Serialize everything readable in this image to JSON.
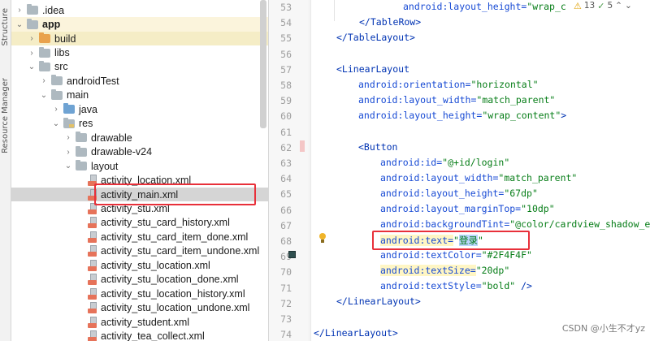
{
  "side_strip": {
    "labels": [
      "Structure",
      "Resource Manager"
    ]
  },
  "project_tree": {
    "items": [
      {
        "label": ".idea",
        "icon": "folder-icon"
      },
      {
        "label": "app",
        "icon": "folder-icon"
      },
      {
        "label": "build",
        "icon": "folder-icon"
      },
      {
        "label": "libs",
        "icon": "folder-icon"
      },
      {
        "label": "src",
        "icon": "folder-icon"
      },
      {
        "label": "androidTest",
        "icon": "folder-icon"
      },
      {
        "label": "main",
        "icon": "folder-icon"
      },
      {
        "label": "java",
        "icon": "folder-icon"
      },
      {
        "label": "res",
        "icon": "folder-icon"
      },
      {
        "label": "drawable",
        "icon": "folder-icon"
      },
      {
        "label": "drawable-v24",
        "icon": "folder-icon"
      },
      {
        "label": "layout",
        "icon": "folder-icon"
      },
      {
        "label": "activity_location.xml",
        "icon": "xml-file-icon"
      },
      {
        "label": "activity_main.xml",
        "icon": "xml-file-icon"
      },
      {
        "label": "activity_stu.xml",
        "icon": "xml-file-icon"
      },
      {
        "label": "activity_stu_card_history.xml",
        "icon": "xml-file-icon"
      },
      {
        "label": "activity_stu_card_item_done.xml",
        "icon": "xml-file-icon"
      },
      {
        "label": "activity_stu_card_item_undone.xml",
        "icon": "xml-file-icon"
      },
      {
        "label": "activity_stu_location.xml",
        "icon": "xml-file-icon"
      },
      {
        "label": "activity_stu_location_done.xml",
        "icon": "xml-file-icon"
      },
      {
        "label": "activity_stu_location_history.xml",
        "icon": "xml-file-icon"
      },
      {
        "label": "activity_stu_location_undone.xml",
        "icon": "xml-file-icon"
      },
      {
        "label": "activity_student.xml",
        "icon": "xml-file-icon"
      },
      {
        "label": "activity_tea_collect.xml",
        "icon": "xml-file-icon"
      }
    ]
  },
  "inspection": {
    "warnings": "13",
    "weak_warnings": "5",
    "warn_icon": "⚠",
    "check_icon": "✓",
    "arrow_up": "⌃",
    "arrow_down": "⌄"
  },
  "editor": {
    "line_numbers": [
      "53",
      "54",
      "55",
      "56",
      "57",
      "58",
      "59",
      "60",
      "61",
      "62",
      "63",
      "64",
      "65",
      "66",
      "67",
      "68",
      "69",
      "70",
      "71",
      "72",
      "73",
      "74"
    ],
    "code": {
      "l53_attr": "android:layout_height=",
      "l53_val": "\"wrap_c",
      "l54": "</TableRow>",
      "l55": "</TableLayout>",
      "l57": "<LinearLayout",
      "l58_attr": "android:orientation=",
      "l58_val": "\"horizontal\"",
      "l59_attr": "android:layout_width=",
      "l59_val": "\"match_parent\"",
      "l60_attr": "android:layout_height=",
      "l60_val": "\"wrap_content\"",
      "l60_end": ">",
      "l62": "<Button",
      "l63_attr": "android:id=",
      "l63_val": "\"@+id/login\"",
      "l64_attr": "android:layout_width=",
      "l64_val": "\"match_parent\"",
      "l65_attr": "android:layout_height=",
      "l65_val": "\"67dp\"",
      "l66_attr": "android:layout_marginTop=",
      "l66_val": "\"10dp\"",
      "l67_attr": "android:backgroundTint=",
      "l67_val": "\"@color/cardview_shadow_e",
      "l68_attr": "android:text=",
      "l68_q1": "\"",
      "l68_val": "登录",
      "l68_q2": "\"",
      "l69_attr": "android:textColor=",
      "l69_val": "\"#2F4F4F\"",
      "l70_attr": "android:textSize=",
      "l70_val": "\"20dp\"",
      "l71_attr": "android:textStyle=",
      "l71_val": "\"bold\"",
      "l71_end": " />",
      "l72": "</LinearLayout>",
      "l74": "</LinearLayout>"
    },
    "text_color_swatch": "#2F4F4F"
  },
  "watermark": "CSDN @小生不才yz"
}
